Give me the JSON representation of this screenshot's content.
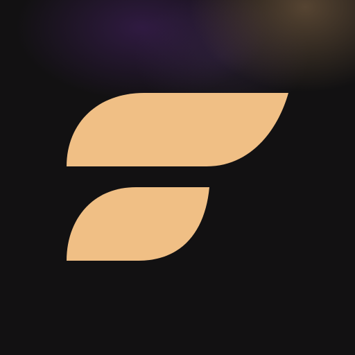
{
  "app_icon": {
    "logo_icon": "stylized-f-logo-icon",
    "colors": {
      "background": "#121112",
      "logo_fill": "#F0BF85",
      "glow_purple": "#482268",
      "glow_gold": "#70583E"
    }
  }
}
